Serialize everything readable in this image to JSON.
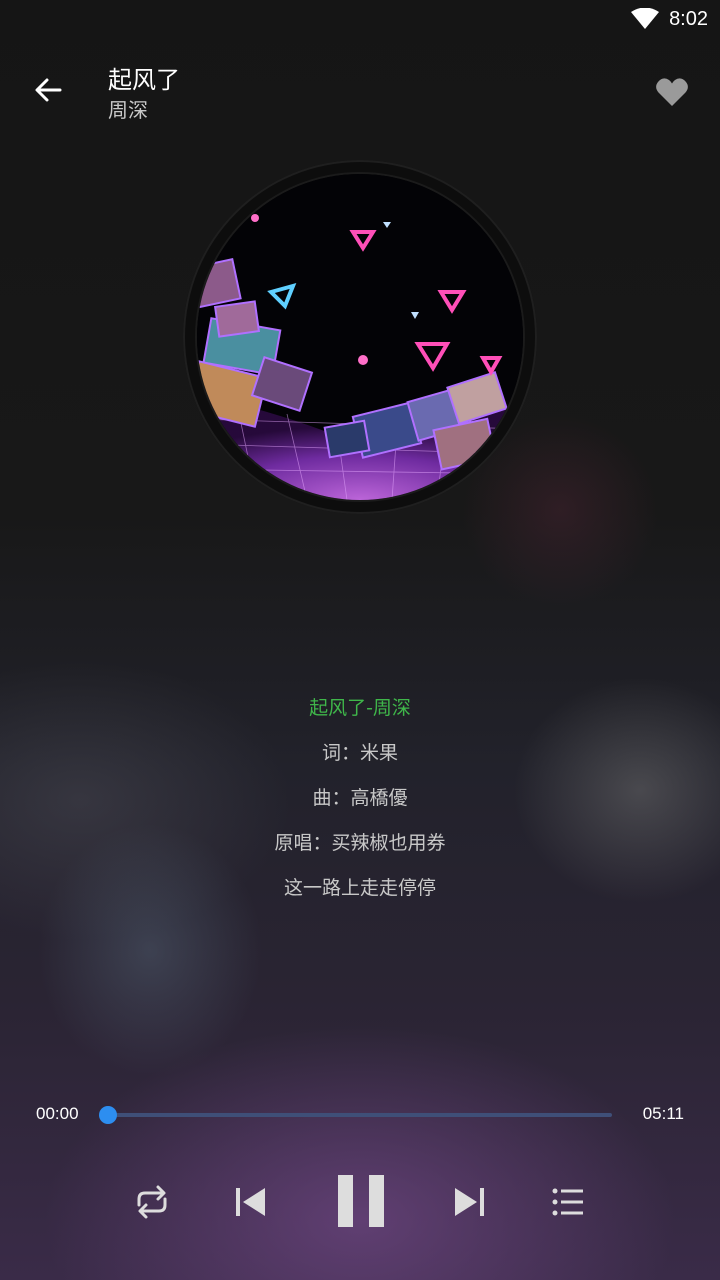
{
  "status_bar": {
    "time": "8:02",
    "wifi_icon": "wifi-icon"
  },
  "header": {
    "back_icon": "arrow-left-icon",
    "song_title": "起风了",
    "artist": "周深",
    "favorite_icon": "heart-icon"
  },
  "lyrics": [
    {
      "text": "起风了-周深",
      "active": true
    },
    {
      "text": "词：米果",
      "active": false
    },
    {
      "text": "曲：高橋優",
      "active": false
    },
    {
      "text": "原唱：买辣椒也用券",
      "active": false
    },
    {
      "text": "这一路上走走停停",
      "active": false
    }
  ],
  "player": {
    "current_time": "00:00",
    "total_time": "05:11",
    "progress": 0,
    "accent_color": "#2d8ef0"
  },
  "controls": {
    "repeat_icon": "repeat-icon",
    "previous_icon": "skip-previous-icon",
    "pause_icon": "pause-icon",
    "next_icon": "skip-next-icon",
    "playlist_icon": "playlist-icon"
  }
}
